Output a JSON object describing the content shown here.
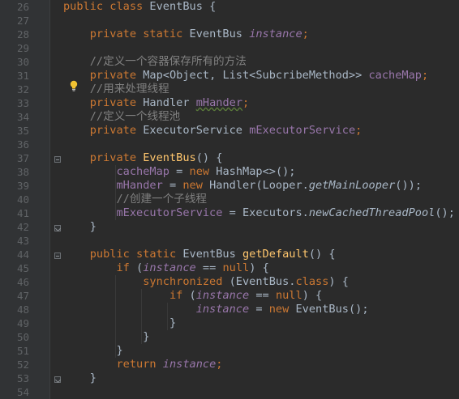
{
  "gutter": {
    "line_numbers": [
      "26",
      "27",
      "28",
      "29",
      "30",
      "31",
      "32",
      "33",
      "34",
      "35",
      "36",
      "37",
      "38",
      "39",
      "40",
      "41",
      "42",
      "43",
      "44",
      "45",
      "46",
      "47",
      "48",
      "49",
      "50",
      "51",
      "52",
      "53",
      "54"
    ]
  },
  "code": {
    "l26": {
      "kw": "public class ",
      "name": "EventBus",
      "rest": " {"
    },
    "l28": {
      "kw": "private static ",
      "type": "EventBus ",
      "field": "instance",
      "end": ";"
    },
    "l30": {
      "comment": "//定义一个容器保存所有的方法"
    },
    "l31": {
      "kw": "private ",
      "type": "Map<Object, List<SubcribeMethod>> ",
      "field": "cacheMap",
      "end": ";"
    },
    "l32": {
      "comment": "//用来处理线程"
    },
    "l33": {
      "kw": "private ",
      "type": "Handler ",
      "field": "mHander",
      "end": ";"
    },
    "l34": {
      "comment": "//定义一个线程池"
    },
    "l35": {
      "kw": "private ",
      "type": "ExecutorService ",
      "field": "mExecutorService",
      "end": ";"
    },
    "l37": {
      "kw": "private ",
      "fn": "EventBus",
      "rest": "() {"
    },
    "l38": {
      "field": "cacheMap",
      "op": " = ",
      "kw": "new ",
      "rest": "HashMap<>();"
    },
    "l39": {
      "field": "mHander",
      "op": " = ",
      "kw": "new ",
      "rest1": "Handler(Looper.",
      "smeth": "getMainLooper",
      "rest2": "());"
    },
    "l40": {
      "comment": "//创建一个子线程"
    },
    "l41": {
      "field": "mExecutorService",
      "op": " = Executors.",
      "smeth": "newCachedThreadPool",
      "rest": "();"
    },
    "l42": {
      "text": "}"
    },
    "l44": {
      "kw": "public static ",
      "type": "EventBus ",
      "fn": "getDefault",
      "rest": "() {"
    },
    "l45": {
      "kw": "if ",
      "p1": "(",
      "field": "instance",
      "op": " == ",
      "kw2": "null",
      "rest": ") {"
    },
    "l46": {
      "kw": "synchronized ",
      "p1": "(EventBus.",
      "kw2": "class",
      "rest": ") {"
    },
    "l47": {
      "kw": "if ",
      "p1": "(",
      "field": "instance",
      "op": " == ",
      "kw2": "null",
      "rest": ") {"
    },
    "l48": {
      "field": "instance",
      "op": " = ",
      "kw": "new ",
      "rest": "EventBus();"
    },
    "l49": {
      "text": "}"
    },
    "l50": {
      "text": "}"
    },
    "l51": {
      "text": "}"
    },
    "l52": {
      "kw": "return ",
      "field": "instance",
      "end": ";"
    },
    "l53": {
      "text": "}"
    }
  }
}
